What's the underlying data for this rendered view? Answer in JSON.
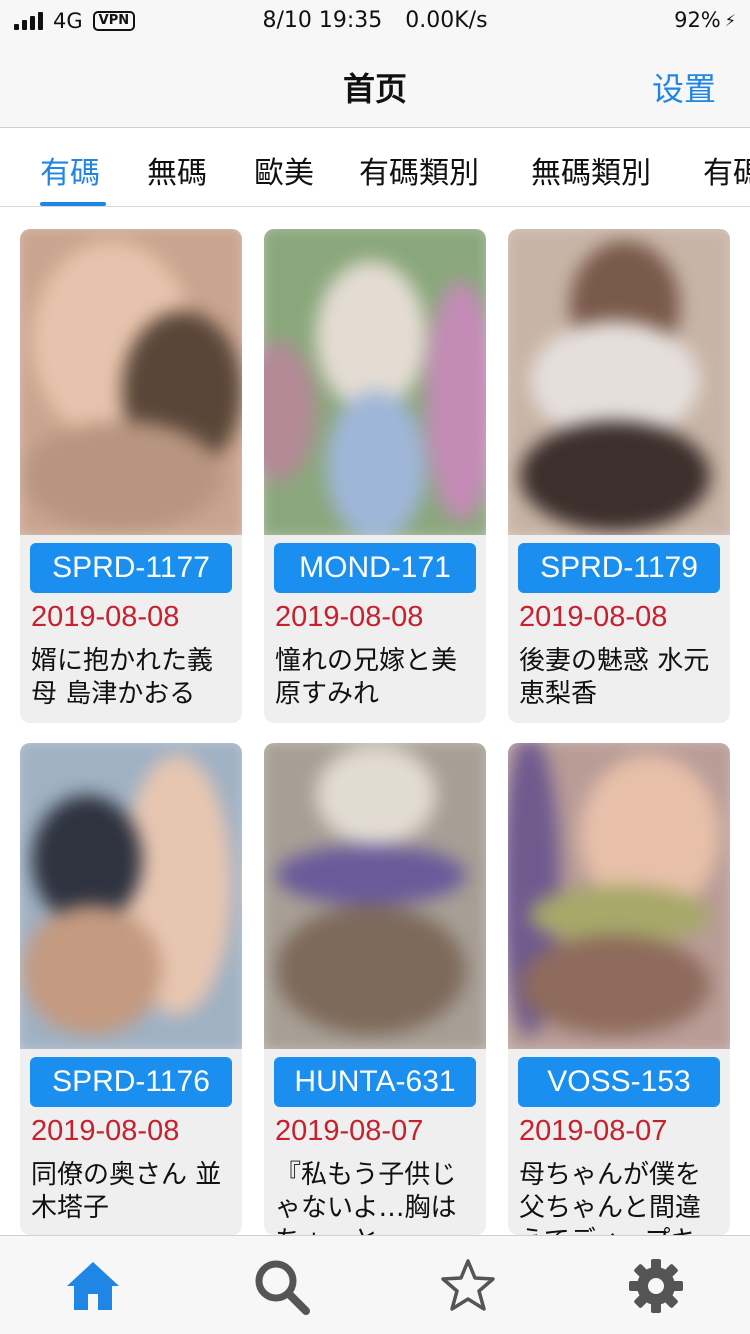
{
  "status": {
    "network": "4G",
    "vpn": "VPN",
    "datetime": "8/10 19:35",
    "speed": "0.00K/s",
    "battery": "92%"
  },
  "nav": {
    "title": "首页",
    "settings": "设置"
  },
  "tabs": [
    "有碼",
    "無碼",
    "歐美",
    "有碼類別",
    "無碼類別",
    "有碼"
  ],
  "active_tab": 0,
  "cards": [
    {
      "id": "SPRD-1177",
      "date": "2019-08-08",
      "title": "婿に抱かれた義母 島津かおる"
    },
    {
      "id": "MOND-171",
      "date": "2019-08-08",
      "title": "憧れの兄嫁と美原すみれ"
    },
    {
      "id": "SPRD-1179",
      "date": "2019-08-08",
      "title": "後妻の魅惑 水元恵梨香"
    },
    {
      "id": "SPRD-1176",
      "date": "2019-08-08",
      "title": "同僚の奥さん 並木塔子"
    },
    {
      "id": "HUNTA-631",
      "date": "2019-08-07",
      "title": "『私もう子供じゃないよ…胸はちょっと…"
    },
    {
      "id": "VOSS-153",
      "date": "2019-08-07",
      "title": "母ちゃんが僕を父ちゃんと間違えてディープキ…"
    }
  ],
  "tab_bar": [
    "home-icon",
    "search-icon",
    "star-icon",
    "gear-icon"
  ],
  "colors": {
    "accent": "#1f86e6",
    "badge": "#1a8ff0",
    "date": "#c8202e"
  }
}
